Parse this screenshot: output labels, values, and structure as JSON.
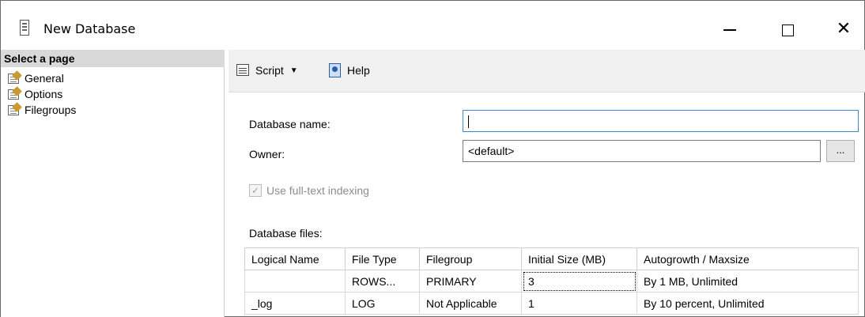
{
  "window": {
    "title": "New Database",
    "icon": "database-icon",
    "controls": {
      "minimize": "minimize-icon",
      "maximize": "maximize-icon",
      "close": "close-icon"
    }
  },
  "sidebar": {
    "header": "Select a page",
    "items": [
      {
        "label": "General",
        "icon": "page-wrench-icon"
      },
      {
        "label": "Options",
        "icon": "page-wrench-icon"
      },
      {
        "label": "Filegroups",
        "icon": "page-wrench-icon"
      }
    ]
  },
  "toolbar": {
    "script_label": "Script",
    "help_label": "Help"
  },
  "form": {
    "db_name_label": "Database name:",
    "db_name_value": "",
    "owner_label": "Owner:",
    "owner_value": "<default>",
    "browse_label": "...",
    "fulltext_label": "Use full-text indexing",
    "fulltext_checked": true,
    "files_label": "Database files:"
  },
  "table": {
    "columns": [
      "Logical Name",
      "File Type",
      "Filegroup",
      "Initial Size (MB)",
      "Autogrowth / Maxsize"
    ],
    "rows": [
      [
        "",
        "ROWS...",
        "PRIMARY",
        "3",
        "By 1 MB, Unlimited"
      ],
      [
        "_log",
        "LOG",
        "Not Applicable",
        "1",
        "By 10 percent, Unlimited"
      ]
    ]
  }
}
